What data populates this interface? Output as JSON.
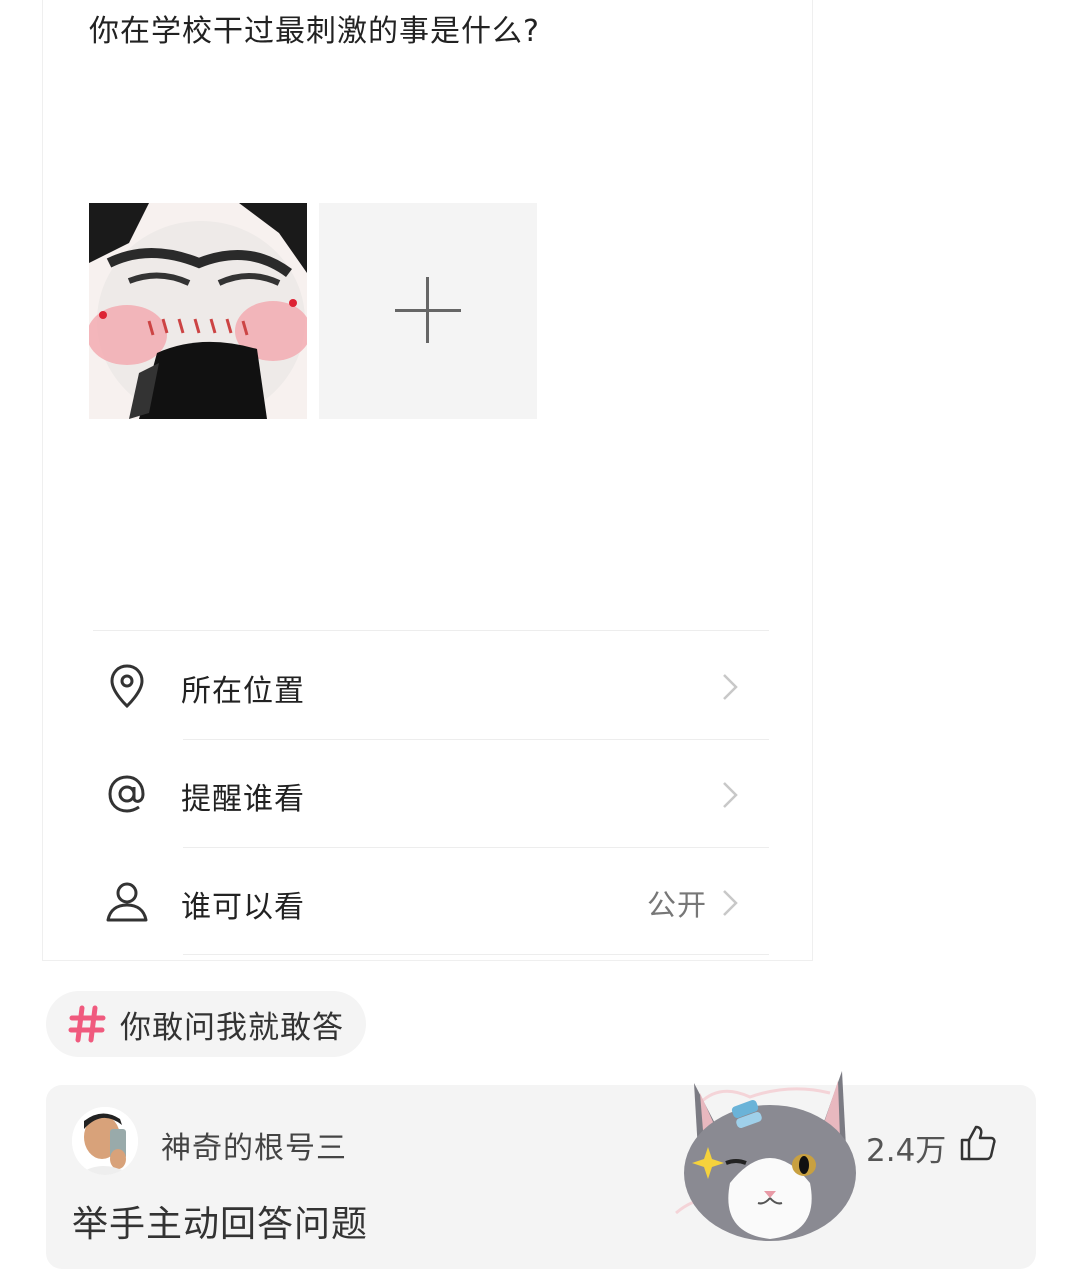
{
  "compose": {
    "question": "你在学校干过最刺激的事是什么?",
    "photo_label": "meme photo thumbnail",
    "options": [
      {
        "label": "所在位置",
        "value": ""
      },
      {
        "label": "提醒谁看",
        "value": ""
      },
      {
        "label": "谁可以看",
        "value": "公开"
      }
    ]
  },
  "topic": {
    "label": "你敢问我就敢答"
  },
  "answer": {
    "username": "神奇的根号三",
    "text": "举手主动回答问题",
    "likes": "2.4万"
  },
  "colors": {
    "hash_accent": "#f05a7e",
    "card_bg": "#f4f4f4",
    "text_primary": "#222222",
    "text_secondary": "#777777"
  },
  "icons": [
    "location-pin-icon",
    "at-sign-icon",
    "person-icon",
    "chevron-right-icon",
    "hashtag-icon",
    "thumbs-up-icon",
    "plus-icon"
  ]
}
